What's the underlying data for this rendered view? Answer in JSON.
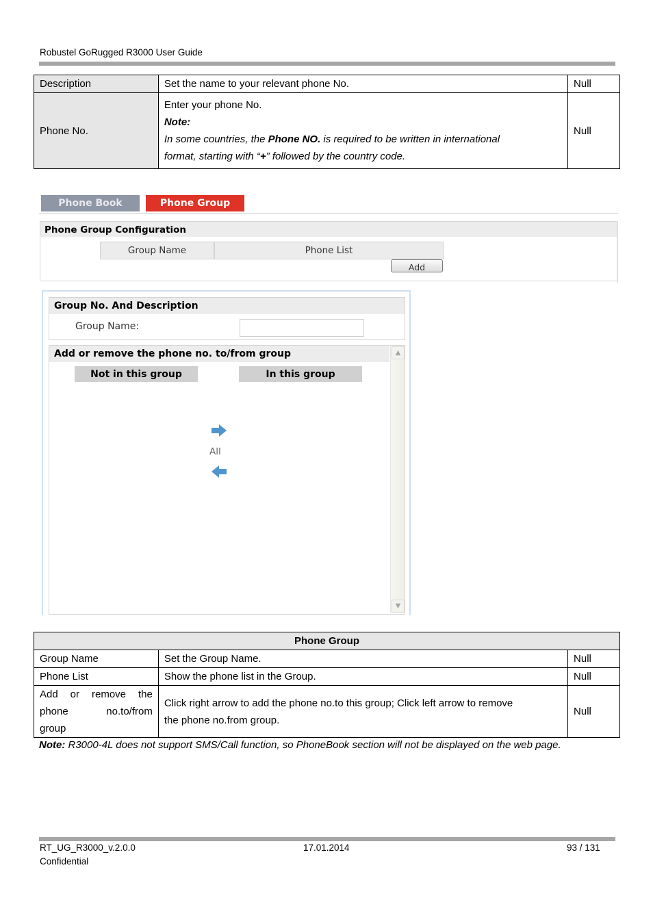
{
  "header": {
    "title": "Robustel GoRugged R3000 User Guide"
  },
  "table1": {
    "rows": [
      {
        "name": "Description",
        "desc": "Set the name to your relevant phone No.",
        "default": "Null"
      },
      {
        "name": "Phone No.",
        "desc_line1": "Enter your phone No.",
        "note_label": "Note:",
        "note_pre": "In some countries, the ",
        "note_bold": "Phone NO.",
        "note_post": " is required to be written in international",
        "note_line2_pre": "format, starting with “",
        "note_line2_bold": "+",
        "note_line2_post": "” followed by the country code.",
        "default": "Null"
      }
    ]
  },
  "ui": {
    "tabs": [
      {
        "label": "Phone Book",
        "active": false
      },
      {
        "label": "Phone Group",
        "active": true
      }
    ],
    "config": {
      "title": "Phone Group Configuration",
      "columns": [
        "Group Name",
        "Phone List"
      ],
      "add_button": "Add"
    },
    "dialog": {
      "section1_title": "Group No. And Description",
      "group_name_label": "Group Name:",
      "group_name_value": "",
      "section2_title": "Add or remove the phone no. to/from group",
      "not_in_group": "Not in this group",
      "in_group": "In this group",
      "all_label": "All"
    },
    "colors": {
      "active_tab": "#e03327",
      "inactive_tab": "#8f96a6",
      "arrow": "#4f95cf"
    }
  },
  "table2": {
    "title": "Phone Group",
    "rows": [
      {
        "name": "Group Name",
        "desc": "Set the Group Name.",
        "default": "Null"
      },
      {
        "name": "Phone List",
        "desc": "Show the phone list in the Group.",
        "default": "Null"
      },
      {
        "name_line1": "Add or remove the",
        "name_line2": "phone no.to/from",
        "name_line3": "group",
        "desc_line1": "Click right arrow to add the phone no.to this group; Click left arrow to remove",
        "desc_line2": "the phone no.from group.",
        "default": "Null"
      }
    ]
  },
  "note": {
    "label": "Note:",
    "text": " R3000-4L does not support SMS/Call function, so PhoneBook section will not be displayed on the web page."
  },
  "footer": {
    "doc_id": "RT_UG_R3000_v.2.0.0",
    "date": "17.01.2014",
    "page": "93 / 131",
    "confidential": "Confidential"
  }
}
